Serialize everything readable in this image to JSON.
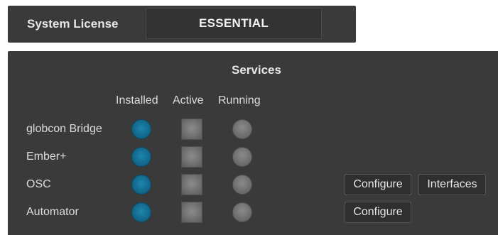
{
  "license": {
    "label": "System License",
    "value": "ESSENTIAL"
  },
  "services": {
    "title": "Services",
    "columns": [
      "Installed",
      "Active",
      "Running"
    ],
    "rows": [
      {
        "name": "globcon Bridge",
        "installed": true,
        "active": false,
        "running": false,
        "buttons": []
      },
      {
        "name": "Ember+",
        "installed": true,
        "active": false,
        "running": false,
        "buttons": []
      },
      {
        "name": "OSC",
        "installed": true,
        "active": false,
        "running": false,
        "buttons": [
          "Configure",
          "Interfaces"
        ]
      },
      {
        "name": "Automator",
        "installed": true,
        "active": false,
        "running": false,
        "buttons": [
          "Configure"
        ]
      }
    ]
  },
  "colors": {
    "panel_bg": "#3a3a3a",
    "installed_led": "#12698c",
    "inactive_indicator": "#6e6e6e",
    "text": "#dcdcdc"
  }
}
